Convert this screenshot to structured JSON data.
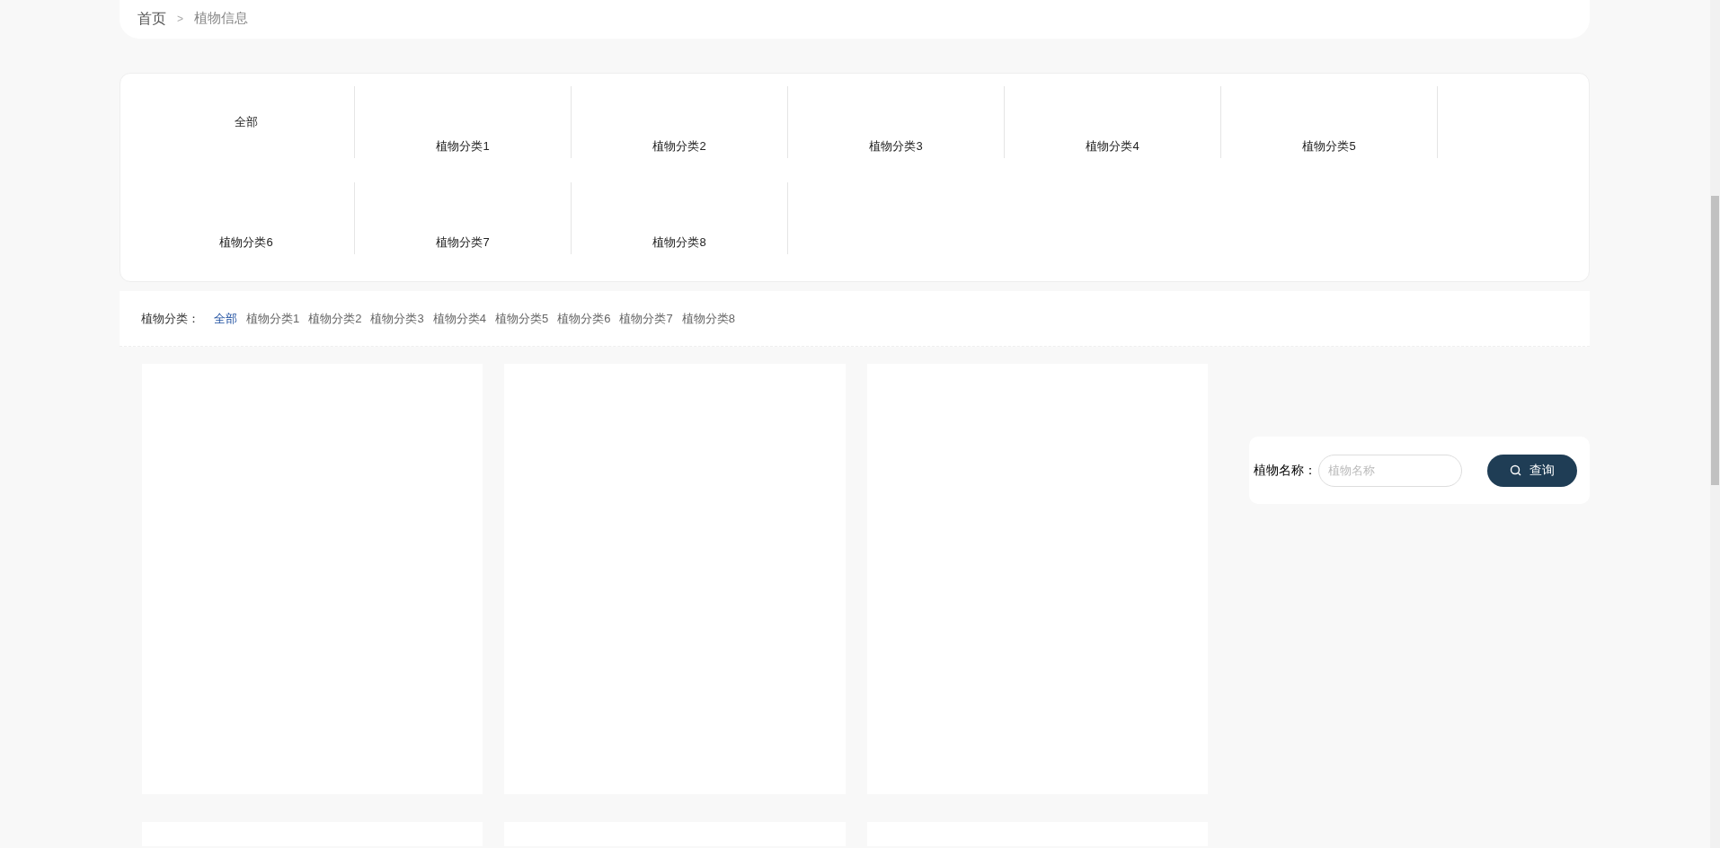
{
  "breadcrumb": {
    "home": "首页",
    "separator": ">",
    "current": "植物信息"
  },
  "category_grid": [
    {
      "kind": "all",
      "label": "全部"
    },
    {
      "kind": "category",
      "label": "植物分类1"
    },
    {
      "kind": "category",
      "label": "植物分类2"
    },
    {
      "kind": "category",
      "label": "植物分类3"
    },
    {
      "kind": "category",
      "label": "植物分类4"
    },
    {
      "kind": "category",
      "label": "植物分类5"
    },
    {
      "kind": "category",
      "label": "植物分类6"
    },
    {
      "kind": "category",
      "label": "植物分类7"
    },
    {
      "kind": "category",
      "label": "植物分类8"
    }
  ],
  "filter": {
    "label": "植物分类：",
    "options": [
      {
        "label": "全部",
        "selected": true
      },
      {
        "label": "植物分类1",
        "selected": false
      },
      {
        "label": "植物分类2",
        "selected": false
      },
      {
        "label": "植物分类3",
        "selected": false
      },
      {
        "label": "植物分类4",
        "selected": false
      },
      {
        "label": "植物分类5",
        "selected": false
      },
      {
        "label": "植物分类6",
        "selected": false
      },
      {
        "label": "植物分类7",
        "selected": false
      },
      {
        "label": "植物分类8",
        "selected": false
      }
    ]
  },
  "search": {
    "label": "植物名称：",
    "placeholder": "植物名称",
    "button": "查询"
  },
  "cards": [
    {
      "kind": "blank"
    },
    {
      "kind": "blank"
    },
    {
      "kind": "blank"
    },
    {
      "kind": "blank"
    },
    {
      "kind": "blank"
    },
    {
      "kind": "blank"
    }
  ]
}
